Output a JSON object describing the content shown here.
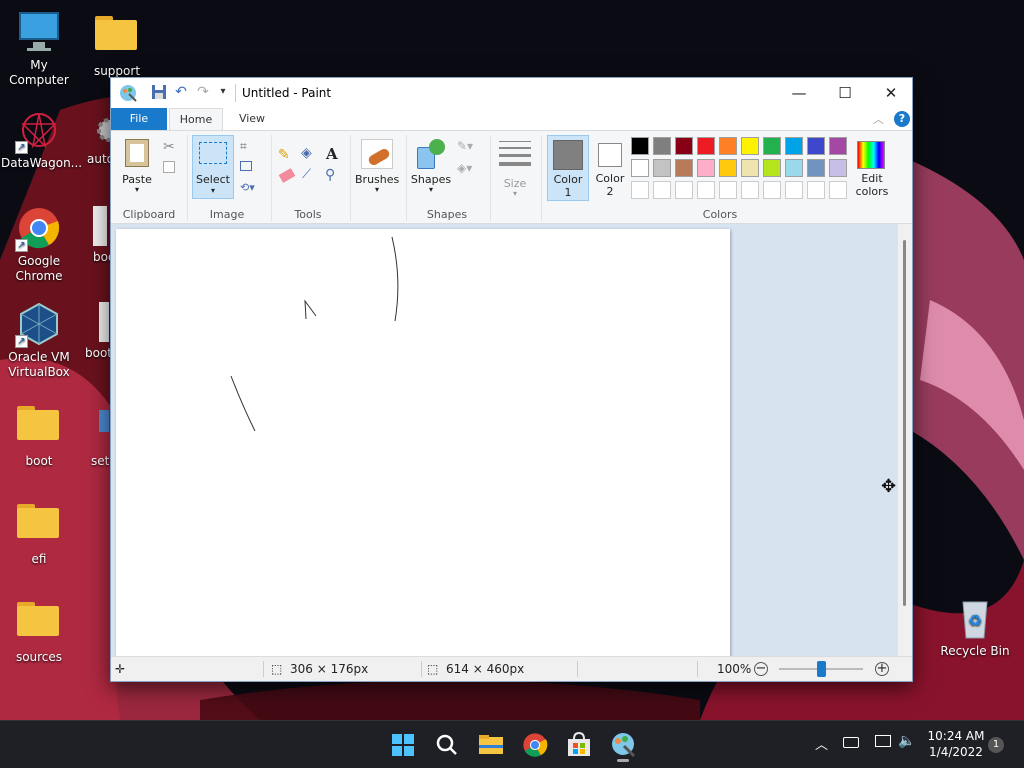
{
  "desktop": {
    "icons": [
      {
        "label": "My Computer"
      },
      {
        "label": "support"
      },
      {
        "label": "DataWagon..."
      },
      {
        "label": "auto"
      },
      {
        "label": "Google Chrome"
      },
      {
        "label": "boo"
      },
      {
        "label": "Oracle VM VirtualBox"
      },
      {
        "label": "boot"
      },
      {
        "label": "boot"
      },
      {
        "label": "setu"
      },
      {
        "label": "efi"
      },
      {
        "label": "sources"
      },
      {
        "label": "Recycle Bin"
      }
    ]
  },
  "window": {
    "title": "Untitled - Paint",
    "tabs": {
      "file": "File",
      "home": "Home",
      "view": "View"
    },
    "ribbon": {
      "clipboard": {
        "paste": "Paste",
        "group": "Clipboard"
      },
      "image": {
        "select": "Select",
        "group": "Image"
      },
      "tools": {
        "group": "Tools"
      },
      "brushes": {
        "label": "Brushes"
      },
      "shapes": {
        "label": "Shapes",
        "group": "Shapes"
      },
      "size": {
        "label": "Size"
      },
      "colors": {
        "color1": "Color 1",
        "color2": "Color 2",
        "edit": "Edit colors",
        "group": "Colors",
        "palette_row1": [
          "#000000",
          "#7f7f7f",
          "#880015",
          "#ed1c24",
          "#ff7f27",
          "#fff200",
          "#22b14c",
          "#00a2e8",
          "#3f48cc",
          "#a349a4"
        ],
        "palette_row2": [
          "#ffffff",
          "#c3c3c3",
          "#b97a57",
          "#ffaec9",
          "#ffc90e",
          "#efe4b0",
          "#b5e61d",
          "#99d9ea",
          "#7092be",
          "#c8bfe7"
        ],
        "color1_value": "#808080",
        "color2_value": "#ffffff"
      }
    },
    "status": {
      "selection_size": "306 × 176px",
      "canvas_size": "614 × 460px",
      "zoom": "100%",
      "zoom_level": 0.5
    }
  },
  "taskbar": {
    "time": "10:24 AM",
    "date": "1/4/2022",
    "notifications": "1"
  }
}
